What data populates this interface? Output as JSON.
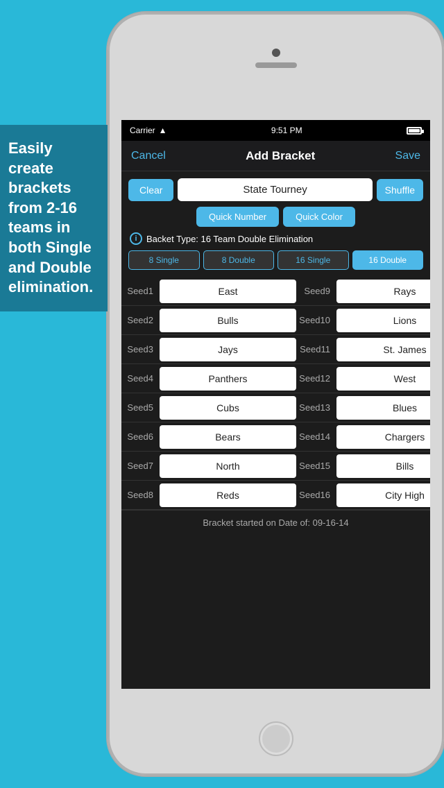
{
  "background": "#29b8d8",
  "left_panel": {
    "text": "Easily create brackets from 2-16 teams in both Single and Double elimination."
  },
  "status_bar": {
    "carrier": "Carrier",
    "time": "9:51 PM",
    "wifi": "wifi"
  },
  "nav": {
    "cancel_label": "Cancel",
    "title": "Add Bracket",
    "save_label": "Save"
  },
  "toolbar": {
    "clear_label": "Clear",
    "tourney_name": "State Tourney",
    "shuffle_label": "Shuffle",
    "quick_number_label": "Quick Number",
    "quick_color_label": "Quick Color"
  },
  "bracket_info": {
    "type_label": "Backet Type: 16 Team Double Elimination"
  },
  "bracket_selector": {
    "options": [
      "8 Single",
      "8 Double",
      "16 Single",
      "16 Double"
    ],
    "active_index": 3
  },
  "seeds": [
    {
      "label": "Seed1",
      "value": "East",
      "col": 0
    },
    {
      "label": "Seed9",
      "value": "Rays",
      "col": 1
    },
    {
      "label": "Seed2",
      "value": "Bulls",
      "col": 0
    },
    {
      "label": "Seed10",
      "value": "Lions",
      "col": 1
    },
    {
      "label": "Seed3",
      "value": "Jays",
      "col": 0
    },
    {
      "label": "Seed11",
      "value": "St. James",
      "col": 1
    },
    {
      "label": "Seed4",
      "value": "Panthers",
      "col": 0
    },
    {
      "label": "Seed12",
      "value": "West",
      "col": 1
    },
    {
      "label": "Seed5",
      "value": "Cubs",
      "col": 0
    },
    {
      "label": "Seed13",
      "value": "Blues",
      "col": 1
    },
    {
      "label": "Seed6",
      "value": "Bears",
      "col": 0
    },
    {
      "label": "Seed14",
      "value": "Chargers",
      "col": 1
    },
    {
      "label": "Seed7",
      "value": "North",
      "col": 0
    },
    {
      "label": "Seed15",
      "value": "Bills",
      "col": 1
    },
    {
      "label": "Seed8",
      "value": "Reds",
      "col": 0
    },
    {
      "label": "Seed16",
      "value": "City High",
      "col": 1
    }
  ],
  "footer": {
    "text": "Bracket started on Date of: 09-16-14"
  }
}
